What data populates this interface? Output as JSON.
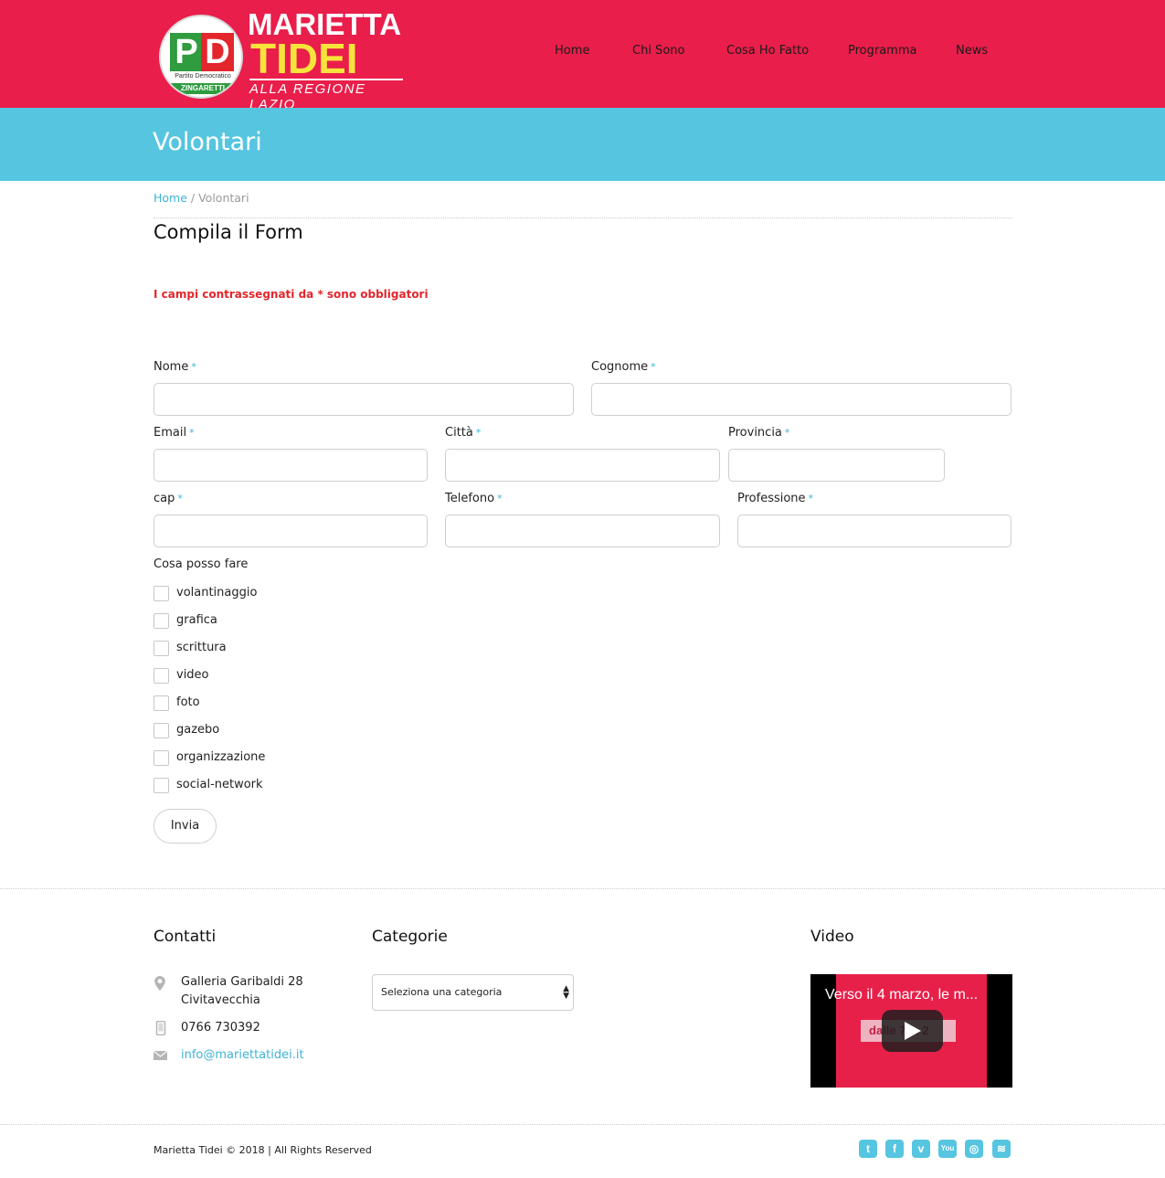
{
  "logo": {
    "circle_letters_p": "P",
    "circle_letters_d": "D",
    "circle_sub": "Partito Democratico",
    "circle_band": "ZINGARETTI",
    "name_first": "MARIETTA",
    "name_last": "TIDEI",
    "tagline": "ALLA REGIONE LAZIO"
  },
  "nav": {
    "items": [
      {
        "label": "Home"
      },
      {
        "label": "Chi Sono"
      },
      {
        "label": "Cosa Ho Fatto"
      },
      {
        "label": "Programma"
      },
      {
        "label": "News"
      }
    ]
  },
  "page": {
    "title": "Volontari",
    "breadcrumb_home": "Home",
    "breadcrumb_sep": " / ",
    "breadcrumb_current": "Volontari"
  },
  "form": {
    "title": "Compila il Form",
    "required_note": "I campi contrassegnati da * sono obbligatori",
    "required_star": "*",
    "fields": {
      "nome": "Nome",
      "cognome": "Cognome",
      "email": "Email",
      "citta": "Città",
      "provincia": "Provincia",
      "cap": "cap",
      "telefono": "Telefono",
      "professione": "Professione"
    },
    "checkbox_group_label": "Cosa posso fare",
    "checkboxes": [
      {
        "label": "volantinaggio"
      },
      {
        "label": "grafica"
      },
      {
        "label": "scrittura"
      },
      {
        "label": "video"
      },
      {
        "label": "foto"
      },
      {
        "label": "gazebo"
      },
      {
        "label": "organizzazione"
      },
      {
        "label": "social-network"
      }
    ],
    "submit_label": "Invia"
  },
  "footer": {
    "contatti_heading": "Contatti",
    "address_line1": "Galleria Garibaldi 28",
    "address_line2": "Civitavecchia",
    "phone": "0766 730392",
    "email": "info@mariettatidei.it",
    "categorie_heading": "Categorie",
    "category_select_value": "Seleziona una categoria",
    "video_heading": "Video",
    "video_title": "Verso il 4 marzo, le m...",
    "video_overlay_text": "dalle 7 ... 2",
    "copyright": "Marietta Tidei © 2018 | All Rights Reserved"
  },
  "social": {
    "twitter": "t",
    "facebook": "f",
    "vimeo": "v",
    "youtube": "You",
    "instagram": "◎",
    "rss": "≋"
  },
  "colors": {
    "header_bg": "#e91e4b",
    "titlebar_bg": "#56c5e0",
    "accent_link": "#3fb3d6",
    "required_red": "#e3262c"
  }
}
